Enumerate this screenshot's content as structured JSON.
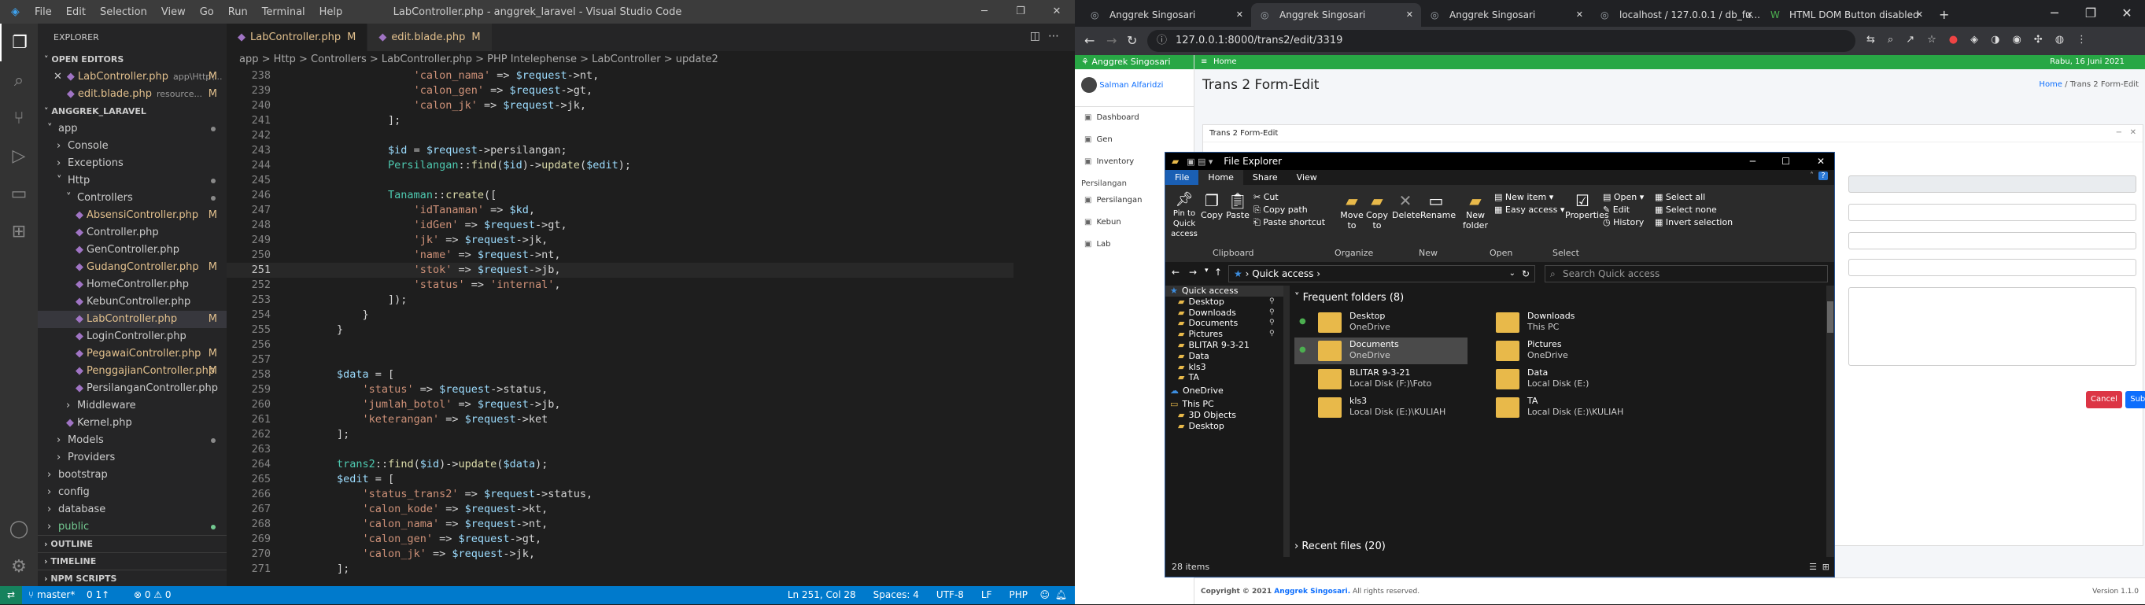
{
  "vscode": {
    "title": "LabController.php - anggrek_laravel - Visual Studio Code",
    "menu": [
      "File",
      "Edit",
      "Selection",
      "View",
      "Go",
      "Run",
      "Terminal",
      "Help"
    ],
    "explorer_label": "EXPLORER",
    "open_editors_label": "OPEN EDITORS",
    "open_editors": [
      {
        "name": "LabController.php",
        "path": "app\\Http\\...",
        "badge": "M"
      },
      {
        "name": "edit.blade.php",
        "path": "resource...",
        "badge": "M"
      }
    ],
    "project_label": "ANGGREK_LARAVEL",
    "tree": [
      {
        "label": "app",
        "indent": 1,
        "type": "folder-open",
        "state": "dot"
      },
      {
        "label": "Console",
        "indent": 2,
        "type": "folder",
        "state": ""
      },
      {
        "label": "Exceptions",
        "indent": 2,
        "type": "folder",
        "state": ""
      },
      {
        "label": "Http",
        "indent": 2,
        "type": "folder-open",
        "state": "dot"
      },
      {
        "label": "Controllers",
        "indent": 3,
        "type": "folder-open",
        "state": "dot"
      },
      {
        "label": "AbsensiController.php",
        "indent": 4,
        "type": "file",
        "state": "M"
      },
      {
        "label": "Controller.php",
        "indent": 4,
        "type": "file",
        "state": ""
      },
      {
        "label": "GenController.php",
        "indent": 4,
        "type": "file",
        "state": ""
      },
      {
        "label": "GudangController.php",
        "indent": 4,
        "type": "file",
        "state": "M"
      },
      {
        "label": "HomeController.php",
        "indent": 4,
        "type": "file",
        "state": ""
      },
      {
        "label": "KebunController.php",
        "indent": 4,
        "type": "file",
        "state": ""
      },
      {
        "label": "LabController.php",
        "indent": 4,
        "type": "file",
        "state": "M",
        "selected": true
      },
      {
        "label": "LoginController.php",
        "indent": 4,
        "type": "file",
        "state": ""
      },
      {
        "label": "PegawaiController.php",
        "indent": 4,
        "type": "file",
        "state": "M"
      },
      {
        "label": "PenggajianController.php",
        "indent": 4,
        "type": "file",
        "state": "M"
      },
      {
        "label": "PersilanganController.php",
        "indent": 4,
        "type": "file",
        "state": ""
      },
      {
        "label": "Middleware",
        "indent": 3,
        "type": "folder",
        "state": ""
      },
      {
        "label": "Kernel.php",
        "indent": 3,
        "type": "file",
        "state": ""
      },
      {
        "label": "Models",
        "indent": 2,
        "type": "folder",
        "state": "dot"
      },
      {
        "label": "Providers",
        "indent": 2,
        "type": "folder",
        "state": ""
      },
      {
        "label": "bootstrap",
        "indent": 1,
        "type": "folder",
        "state": ""
      },
      {
        "label": "config",
        "indent": 1,
        "type": "folder",
        "state": ""
      },
      {
        "label": "database",
        "indent": 1,
        "type": "folder",
        "state": ""
      },
      {
        "label": "public",
        "indent": 1,
        "type": "folder",
        "state": "dot-green"
      }
    ],
    "bottom_sections": [
      "OUTLINE",
      "TIMELINE",
      "NPM SCRIPTS"
    ],
    "tabs": [
      {
        "label": "LabController.php",
        "badge": "M",
        "active": true
      },
      {
        "label": "edit.blade.php",
        "badge": "M",
        "active": false
      }
    ],
    "breadcrumb": "app > Http > Controllers > LabController.php > PHP Intelephense > LabController > update2",
    "code_lines": [
      {
        "n": "238",
        "t": "                    'calon_nama' => $request->nt,"
      },
      {
        "n": "239",
        "t": "                    'calon_gen' => $request->gt,"
      },
      {
        "n": "240",
        "t": "                    'calon_jk' => $request->jk,"
      },
      {
        "n": "241",
        "t": "                ];"
      },
      {
        "n": "242",
        "t": ""
      },
      {
        "n": "243",
        "t": "                $id = $request->persilangan;"
      },
      {
        "n": "244",
        "t": "                Persilangan::find($id)->update($edit);"
      },
      {
        "n": "245",
        "t": ""
      },
      {
        "n": "246",
        "t": "                Tanaman::create(["
      },
      {
        "n": "247",
        "t": "                    'idTanaman' => $kd,"
      },
      {
        "n": "248",
        "t": "                    'idGen' => $request->gt,"
      },
      {
        "n": "249",
        "t": "                    'jk' => $request->jk,"
      },
      {
        "n": "250",
        "t": "                    'name' => $request->nt,"
      },
      {
        "n": "251",
        "t": "                    'stok' => $request->jb,"
      },
      {
        "n": "252",
        "t": "                    'status' => 'internal',"
      },
      {
        "n": "253",
        "t": "                ]);"
      },
      {
        "n": "254",
        "t": "            }"
      },
      {
        "n": "255",
        "t": "        }"
      },
      {
        "n": "256",
        "t": ""
      },
      {
        "n": "257",
        "t": ""
      },
      {
        "n": "258",
        "t": "        $data = ["
      },
      {
        "n": "259",
        "t": "            'status' => $request->status,"
      },
      {
        "n": "260",
        "t": "            'jumlah_botol' => $request->jb,"
      },
      {
        "n": "261",
        "t": "            'keterangan' => $request->ket"
      },
      {
        "n": "262",
        "t": "        ];"
      },
      {
        "n": "263",
        "t": ""
      },
      {
        "n": "264",
        "t": "        trans2::find($id)->update($data);"
      },
      {
        "n": "265",
        "t": "        $edit = ["
      },
      {
        "n": "266",
        "t": "            'status_trans2' => $request->status,"
      },
      {
        "n": "267",
        "t": "            'calon_kode' => $request->kt,"
      },
      {
        "n": "268",
        "t": "            'calon_nama' => $request->nt,"
      },
      {
        "n": "269",
        "t": "            'calon_gen' => $request->gt,"
      },
      {
        "n": "270",
        "t": "            'calon_jk' => $request->jk,"
      },
      {
        "n": "271",
        "t": "        ];"
      }
    ],
    "status_left": [
      "master*",
      "0 1↑",
      "⊗ 0 ⚠ 0"
    ],
    "status_right": [
      "Ln 251, Col 28",
      "Spaces: 4",
      "UTF-8",
      "LF",
      "PHP"
    ]
  },
  "chrome": {
    "tabs": [
      "Anggrek Singosari",
      "Anggrek Singosari",
      "Anggrek Singosari",
      "localhost / 127.0.0.1 / db_fu...",
      "HTML DOM Button disabled"
    ],
    "url": "127.0.0.1:8000/trans2/edit/3319",
    "app": {
      "brand": "Anggrek Singosari",
      "user": "Salman Alfaridzi",
      "nav": [
        "Dashboard",
        "Gen",
        "Inventory"
      ],
      "section": "Persilangan",
      "nav2": [
        "Persilangan",
        "Kebun",
        "Lab"
      ],
      "top_home": "Home",
      "date": "Rabu, 16 Juni 2021",
      "page_title": "Trans 2 Form-Edit",
      "crumb_home": "Home",
      "crumb_current": "Trans 2 Form-Edit",
      "card_title": "Trans 2 Form-Edit",
      "cancel": "Cancel",
      "submit": "Submit",
      "footer": "Copyright © 2021",
      "footer_brand": "Anggrek Singosari.",
      "footer_rights": "All rights reserved.",
      "version": "Version 1.1.0"
    }
  },
  "file_explorer": {
    "title": "File Explorer",
    "ribbon_tabs": [
      "File",
      "Home",
      "Share",
      "View"
    ],
    "clipboard": [
      "Pin to Quick access",
      "Copy",
      "Paste"
    ],
    "clipboard_small": [
      "Cut",
      "Copy path",
      "Paste shortcut"
    ],
    "organize": [
      "Move to",
      "Copy to",
      "Delete",
      "Rename"
    ],
    "new": [
      "New folder"
    ],
    "new_small": [
      "New item",
      "Easy access"
    ],
    "open": [
      "Properties"
    ],
    "open_small": [
      "Open",
      "Edit",
      "History"
    ],
    "select_small": [
      "Select all",
      "Select none",
      "Invert selection"
    ],
    "groups": [
      "Clipboard",
      "Organize",
      "New",
      "Open",
      "Select"
    ],
    "address": "Quick access",
    "search_placeholder": "Search Quick access",
    "nav": [
      "Quick access",
      "Desktop",
      "Downloads",
      "Documents",
      "Pictures",
      "BLITAR 9-3-21",
      "Data",
      "kls3",
      "TA",
      "OneDrive",
      "This PC",
      "3D Objects",
      "Desktop"
    ],
    "frequent_header": "Frequent folders (8)",
    "folders": [
      {
        "name": "Desktop",
        "sub": "OneDrive"
      },
      {
        "name": "Downloads",
        "sub": "This PC"
      },
      {
        "name": "Documents",
        "sub": "OneDrive"
      },
      {
        "name": "Pictures",
        "sub": "OneDrive"
      },
      {
        "name": "BLITAR 9-3-21",
        "sub": "Local Disk (F:)\\Foto"
      },
      {
        "name": "Data",
        "sub": "Local Disk (E:)"
      },
      {
        "name": "kls3",
        "sub": "Local Disk (E:)\\KULIAH"
      },
      {
        "name": "TA",
        "sub": "Local Disk (E:)\\KULIAH"
      }
    ],
    "recent_header": "Recent files (20)",
    "items_count": "28 items"
  }
}
